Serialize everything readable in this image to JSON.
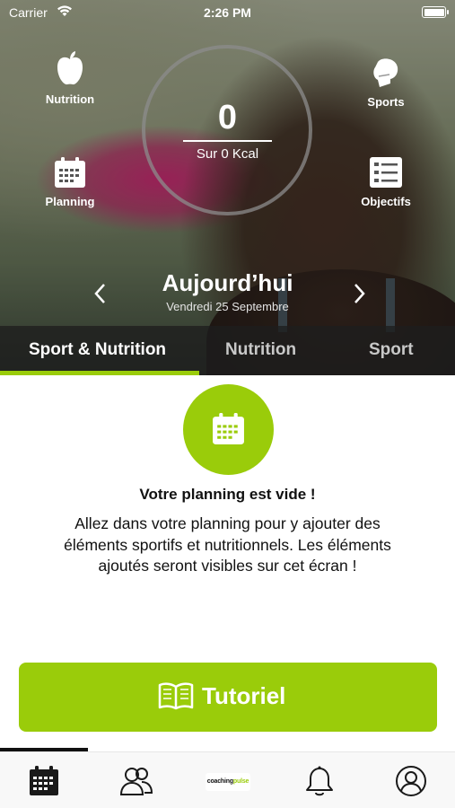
{
  "status_bar": {
    "carrier": "Carrier",
    "time": "2:26 PM"
  },
  "hero": {
    "kcal_value": "0",
    "kcal_label": "Sur 0 Kcal",
    "items": {
      "nutrition": "Nutrition",
      "sports": "Sports",
      "planning": "Planning",
      "objectifs": "Objectifs"
    },
    "day_title": "Aujourd’hui",
    "day_date": "Vendredi 25 Septembre"
  },
  "tabs": [
    {
      "label": "Sport & Nutrition",
      "active": true
    },
    {
      "label": "Nutrition",
      "active": false
    },
    {
      "label": "Sport",
      "active": false
    }
  ],
  "empty_state": {
    "title": "Votre planning est vide !",
    "text": "Allez dans votre planning pour y ajouter des éléments sportifs et nutritionnels. Les éléments ajoutés seront visibles sur cet écran !"
  },
  "tutorial_button": {
    "label": "Tutoriel"
  },
  "bottom_nav": {
    "items": [
      "calendar-icon",
      "community-icon",
      "brand-logo",
      "bell-icon",
      "profile-icon"
    ],
    "brand_text": "coaching",
    "brand_accent": "pulse",
    "active_index": 0
  },
  "colors": {
    "accent": "#9acc0a",
    "tab_bar": "#1e1e1e"
  }
}
